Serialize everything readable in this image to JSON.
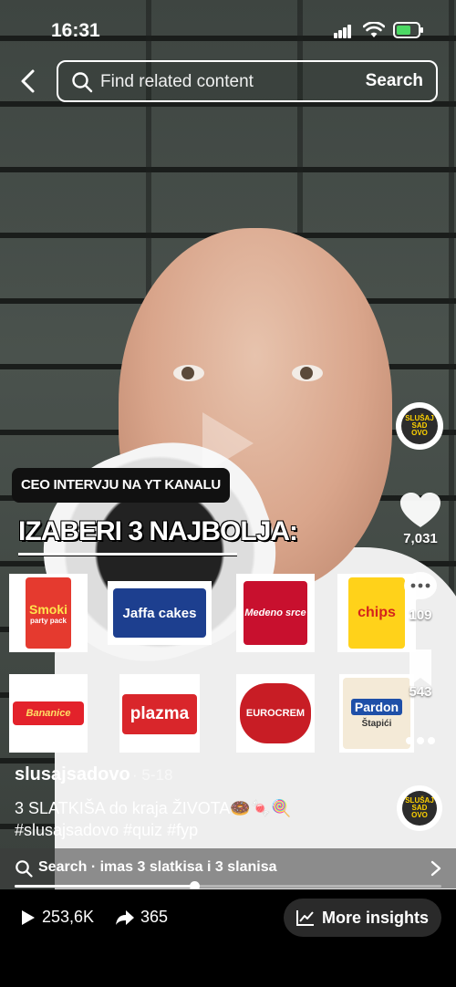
{
  "status_bar": {
    "time": "16:31"
  },
  "header": {
    "search_placeholder": "Find related content",
    "search_button": "Search"
  },
  "overlay": {
    "pill": "CEO INTERVJU NA YT KANALU",
    "title": "IZABERI 3 NAJBOLJA:",
    "products_row1": [
      {
        "name": "Smoki",
        "sub": "party pack",
        "bg": "#e53a2f",
        "fg": "#ffe34d"
      },
      {
        "name": "Jaffa cakes",
        "sub": "",
        "bg": "#1d3f8f",
        "fg": "#ffffff"
      },
      {
        "name": "Medeno srce",
        "sub": "",
        "bg": "#c8102e",
        "fg": "#ffffff"
      },
      {
        "name": "chips",
        "sub": "",
        "bg": "#ffd21a",
        "fg": "#d4231c"
      }
    ],
    "products_row2": [
      {
        "name": "Bananice",
        "sub": "",
        "bg": "#e3222b",
        "fg": "#ffe066"
      },
      {
        "name": "plazma",
        "sub": "",
        "bg": "#d9262b",
        "fg": "#ffffff"
      },
      {
        "name": "EUROCREM",
        "sub": "",
        "bg": "#c81d25",
        "fg": "#ffffff"
      },
      {
        "name": "Pardon",
        "sub": "Štapići",
        "bg": "#1e4fa8",
        "fg": "#ffffff"
      }
    ]
  },
  "rail": {
    "avatar_text": "SLUŠAJ SAD OVO",
    "likes": "7,031",
    "comments": "109",
    "saves": "543"
  },
  "post": {
    "username": "slusajsadovo",
    "date": "· 5-18",
    "caption_line1": "3 SLATKIŠA do kraja ŽIVOTA🍩🍬🍭",
    "caption_line2": "#slusajsadovo #quiz #fyp"
  },
  "related": {
    "text": "Search · imas 3 slatkisa i 3 slanisa"
  },
  "playback": {
    "progress": 0.42
  },
  "bottom": {
    "views": "253,6K",
    "shares": "365",
    "insights_label": "More insights"
  }
}
